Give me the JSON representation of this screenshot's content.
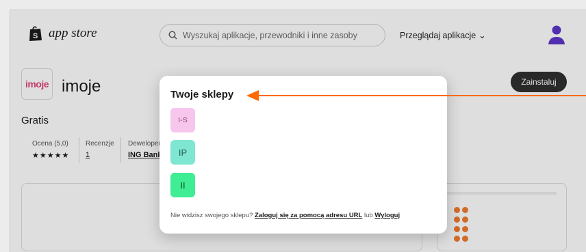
{
  "header": {
    "logo_text": "app store",
    "search_placeholder": "Wyszukaj aplikacje, przewodniki i inne zasoby",
    "browse_label": "Przeglądaj aplikacje",
    "browse_chevron": "⌄"
  },
  "app": {
    "logo_text": "imoje",
    "name": "imoje",
    "price": "Gratis",
    "rating_label": "Ocena (5,0)",
    "stars": "★★★★★",
    "reviews_label": "Recenzje",
    "reviews_count": "1",
    "developer_label": "Deweloper",
    "developer_value": "ING Bank",
    "install_label": "Zainstaluj",
    "card_word": "imoje"
  },
  "modal": {
    "title": "Twoje sklepy",
    "stores": [
      {
        "initials": "I-S",
        "color": "#f7c6ec"
      },
      {
        "initials": "IP",
        "color": "#7fe6d1"
      },
      {
        "initials": "II",
        "color": "#3fed94"
      }
    ],
    "footer_text": "Nie widzisz swojego sklepu?",
    "login_link": "Zaloguj się za pomocą adresu URL",
    "or_text": "lub",
    "logout_link": "Wyloguj"
  },
  "colors": {
    "annotation_arrow": "#ff6a00",
    "brand_pink": "#e0457b",
    "avatar": "#5c35c9"
  },
  "icons": [
    "shopify-bag-icon",
    "search-icon",
    "chevron-down-icon",
    "user-avatar-icon",
    "annotation-arrow"
  ]
}
